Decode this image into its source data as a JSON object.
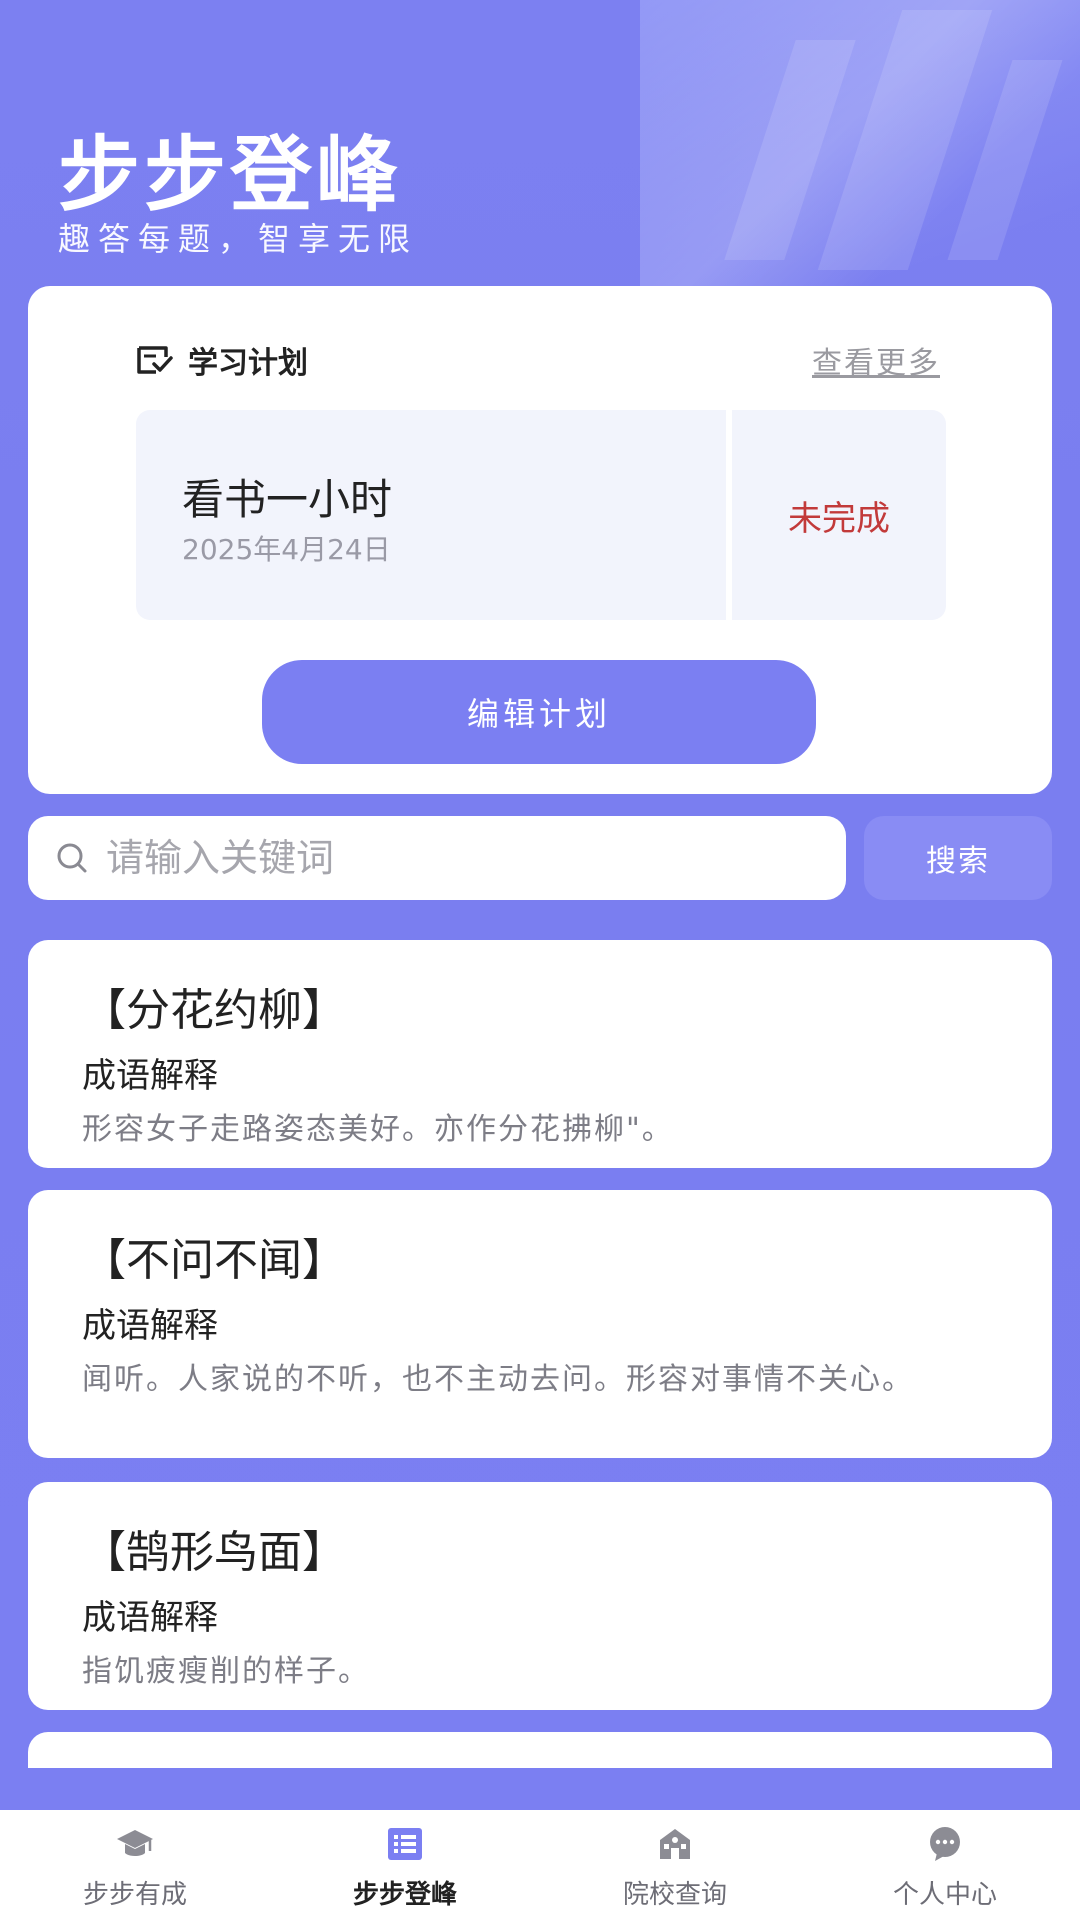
{
  "header": {
    "title": "步步登峰",
    "subtitle": "趣答每题，智享无限"
  },
  "plan": {
    "section_label": "学习计划",
    "more_label": "查看更多",
    "task": "看书一小时",
    "date": "2025年4月24日",
    "status": "未完成",
    "edit_label": "编辑计划"
  },
  "search": {
    "placeholder": "请输入关键词",
    "button_label": "搜索"
  },
  "idioms": [
    {
      "title": "【分花约柳】",
      "sub": "成语解释",
      "desc": "形容女子走路姿态美好。亦作分花拂柳\"。"
    },
    {
      "title": "【不问不闻】",
      "sub": "成语解释",
      "desc": "闻听。人家说的不听，也不主动去问。形容对事情不关心。"
    },
    {
      "title": "【鹄形鸟面】",
      "sub": "成语解释",
      "desc": "指饥疲瘦削的样子。"
    }
  ],
  "tabs": [
    {
      "label": "步步有成",
      "icon": "graduation-cap-icon"
    },
    {
      "label": "步步登峰",
      "icon": "list-icon"
    },
    {
      "label": "院校查询",
      "icon": "school-icon"
    },
    {
      "label": "个人中心",
      "icon": "chat-bubble-icon"
    }
  ],
  "colors": {
    "primary": "#7b7ff2",
    "status_incomplete": "#c23a3a",
    "background": "#7a7ef0"
  }
}
